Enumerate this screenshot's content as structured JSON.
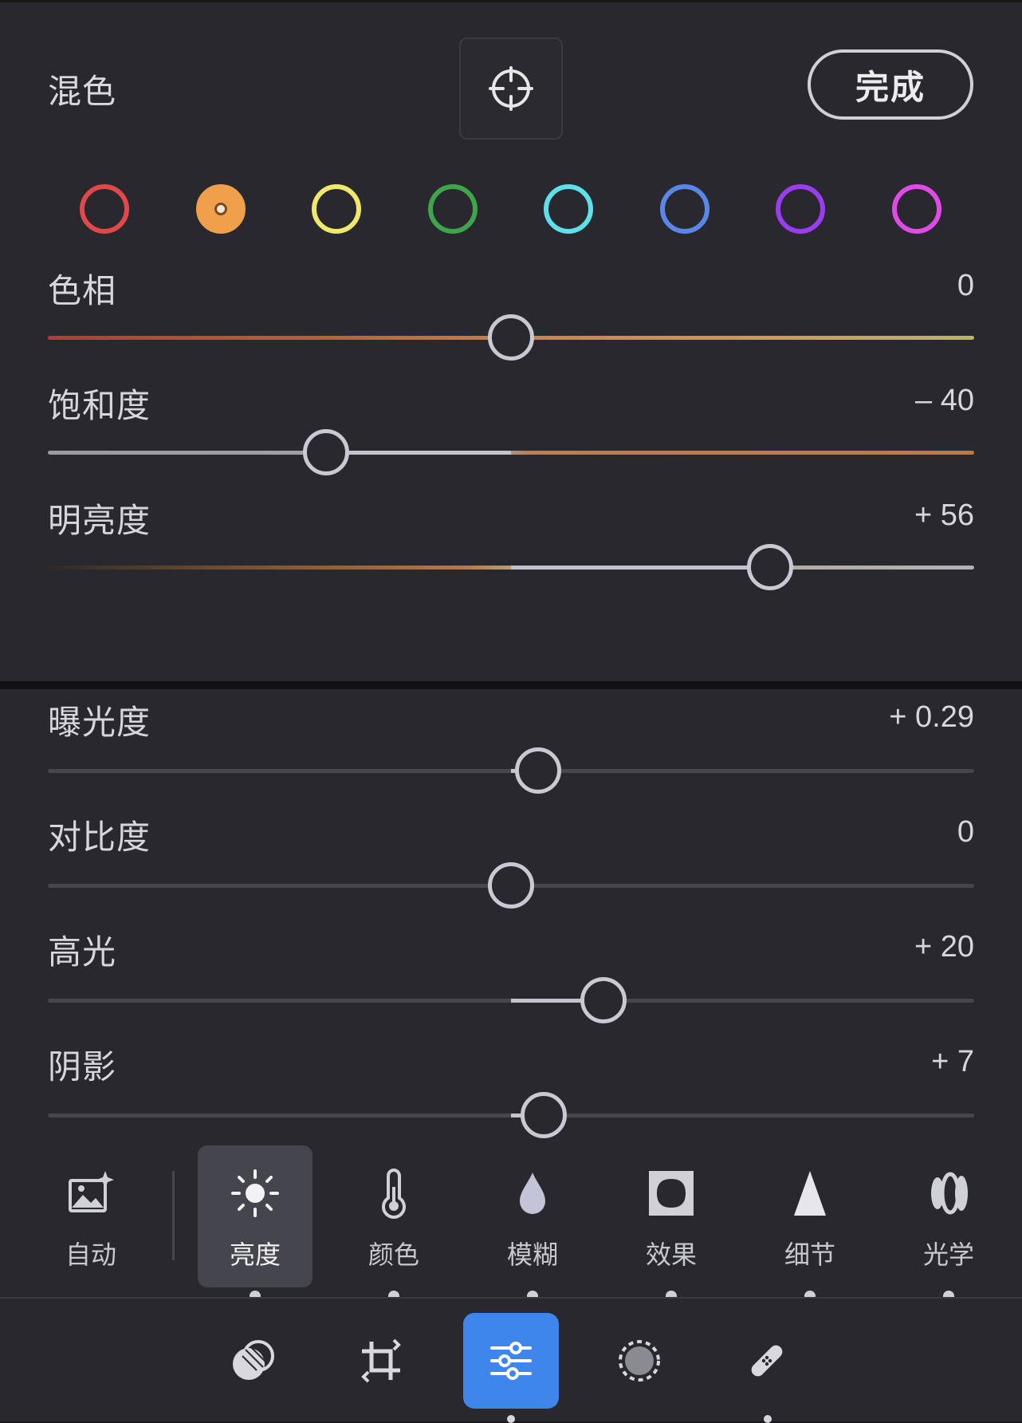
{
  "mix_panel": {
    "title": "混色",
    "done_label": "完成",
    "colors": [
      {
        "name": "red",
        "color": "#e0484a",
        "selected": false
      },
      {
        "name": "orange",
        "color": "#f0a04b",
        "selected": true
      },
      {
        "name": "yellow",
        "color": "#f0e86a",
        "selected": false
      },
      {
        "name": "green",
        "color": "#3ea64a",
        "selected": false
      },
      {
        "name": "aqua",
        "color": "#5ee0ea",
        "selected": false
      },
      {
        "name": "blue",
        "color": "#5a86ea",
        "selected": false
      },
      {
        "name": "purple",
        "color": "#9a3cf0",
        "selected": false
      },
      {
        "name": "magenta",
        "color": "#e04ae6",
        "selected": false
      }
    ],
    "sliders": [
      {
        "label": "色相",
        "value_text": "0",
        "value": 0,
        "min": -100,
        "max": 100
      },
      {
        "label": "饱和度",
        "value_text": "– 40",
        "value": -40,
        "min": -100,
        "max": 100
      },
      {
        "label": "明亮度",
        "value_text": "+ 56",
        "value": 56,
        "min": -100,
        "max": 100
      }
    ]
  },
  "light_panel": {
    "sliders": [
      {
        "label": "曝光度",
        "value_text": "+ 0.29",
        "value": 0.29,
        "min": -5,
        "max": 5
      },
      {
        "label": "对比度",
        "value_text": "0",
        "value": 0,
        "min": -100,
        "max": 100
      },
      {
        "label": "高光",
        "value_text": "+ 20",
        "value": 20,
        "min": -100,
        "max": 100
      },
      {
        "label": "阴影",
        "value_text": "+ 7",
        "value": 7,
        "min": -100,
        "max": 100
      }
    ]
  },
  "tools": [
    {
      "label": "自动",
      "icon": "auto-image-icon",
      "active": false
    },
    {
      "label": "亮度",
      "icon": "sun-icon",
      "active": true
    },
    {
      "label": "颜色",
      "icon": "thermometer-icon",
      "active": false
    },
    {
      "label": "模糊",
      "icon": "drop-icon",
      "active": false
    },
    {
      "label": "效果",
      "icon": "vignette-icon",
      "active": false
    },
    {
      "label": "细节",
      "icon": "triangle-icon",
      "active": false
    },
    {
      "label": "光学",
      "icon": "lens-icon",
      "active": false
    }
  ],
  "nav": [
    {
      "icon": "presets-icon",
      "active": false
    },
    {
      "icon": "crop-rotate-icon",
      "active": false
    },
    {
      "icon": "adjust-sliders-icon",
      "active": true
    },
    {
      "icon": "masking-icon",
      "active": false
    },
    {
      "icon": "healing-bandage-icon",
      "active": false
    }
  ],
  "colors": {
    "panel_bg": "#28282e",
    "accent_blue": "#3f86ec",
    "thumb": "#c9c9d4"
  }
}
